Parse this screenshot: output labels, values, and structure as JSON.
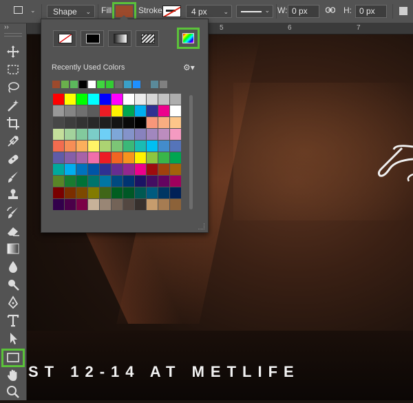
{
  "options_bar": {
    "tool_preset_icon": "rectangle-tool-icon",
    "mode": "Shape",
    "fill_label": "Fill:",
    "fill_color": "#9c4a2c",
    "stroke_label": "Stroke:",
    "stroke_width": "4 px",
    "w_label": "W:",
    "w_value": "0 px",
    "h_label": "H:",
    "h_value": "0 px"
  },
  "ruler": {
    "ticks": [
      "5",
      "6",
      "7"
    ]
  },
  "fill_popover": {
    "paint_types": [
      "no-color",
      "solid-color",
      "gradient",
      "pattern"
    ],
    "recent_label": "Recently Used Colors",
    "recent_colors": [
      "#9c4a2c",
      "#6ab04c",
      "#5cb85c",
      "#000000",
      "#ffffff",
      "#3fd63f",
      "#33cc33",
      "#6a6a6a",
      "#3aa0c8",
      "#1e90ff",
      "#555555",
      "#5a8a9a",
      "#808080"
    ],
    "swatch_rows": [
      [
        "#ff0000",
        "#ffff00",
        "#00ff00",
        "#00ffff",
        "#0000ff",
        "#ff00ff",
        "#ffffff",
        "#ebebeb",
        "#d6d6d6",
        "#c2c2c2",
        "#adadad"
      ],
      [
        "#999999",
        "#858585",
        "#707070",
        "#5c5c5c",
        "#ed1c24",
        "#fff200",
        "#00a651",
        "#00aeef",
        "#2e3192",
        "#ec008c",
        "#ffffff"
      ],
      [
        "#474747",
        "#3d3d3d",
        "#333333",
        "#292929",
        "#1f1f1f",
        "#141414",
        "#0a0a0a",
        "#000000",
        "#f7977a",
        "#f9ad81",
        "#fdc68a"
      ],
      [
        "#c4df9b",
        "#a3d39c",
        "#82ca9d",
        "#7bcdc8",
        "#6ecff6",
        "#7ea7d8",
        "#8493ca",
        "#8882be",
        "#a187be",
        "#bc8dbf",
        "#f49ac1"
      ],
      [
        "#f26c4f",
        "#f68e56",
        "#fbaf5c",
        "#fff467",
        "#acd372",
        "#7cc576",
        "#3bb878",
        "#1abbb4",
        "#00bff3",
        "#438ccb",
        "#5574b9"
      ],
      [
        "#605ca8",
        "#855fa8",
        "#a763a8",
        "#f06eaa",
        "#ed1c24",
        "#f26522",
        "#f7941d",
        "#fff200",
        "#8dc63f",
        "#39b54a",
        "#00a651"
      ],
      [
        "#00a99d",
        "#00aeef",
        "#0072bc",
        "#0054a6",
        "#2e3192",
        "#662d91",
        "#92278f",
        "#ec008c",
        "#9e0b0f",
        "#a0410d",
        "#a3620a"
      ],
      [
        "#598527",
        "#197b30",
        "#007236",
        "#00746b",
        "#0076a3",
        "#004a80",
        "#003471",
        "#1b1464",
        "#440e62",
        "#630460",
        "#9e005d"
      ],
      [
        "#790000",
        "#7b2e00",
        "#7d4900",
        "#827b00",
        "#406618",
        "#005e20",
        "#005826",
        "#005952",
        "#005b7f",
        "#003663",
        "#002157"
      ],
      [
        "#32004b",
        "#4b0049",
        "#7b0046",
        "#c7b299",
        "#998675",
        "#736357",
        "#534741",
        "#37302d",
        "#c69c6d",
        "#a67c52",
        "#8c6239"
      ]
    ]
  },
  "toolbar": {
    "tools": [
      "move-tool-icon",
      "marquee-tool-icon",
      "lasso-tool-icon",
      "magic-wand-tool-icon",
      "crop-tool-icon",
      "eyedropper-tool-icon",
      "healing-brush-tool-icon",
      "brush-tool-icon",
      "clone-stamp-tool-icon",
      "history-brush-tool-icon",
      "eraser-tool-icon",
      "gradient-tool-icon",
      "blur-tool-icon",
      "dodge-tool-icon",
      "pen-tool-icon",
      "type-tool-icon",
      "path-selection-tool-icon",
      "rectangle-tool-icon",
      "hand-tool-icon",
      "zoom-tool-icon"
    ]
  },
  "canvas": {
    "poster_text": "ST 12-14 AT METLIFE"
  },
  "colors": {
    "highlight": "#5bc23a",
    "panel": "#535353"
  }
}
